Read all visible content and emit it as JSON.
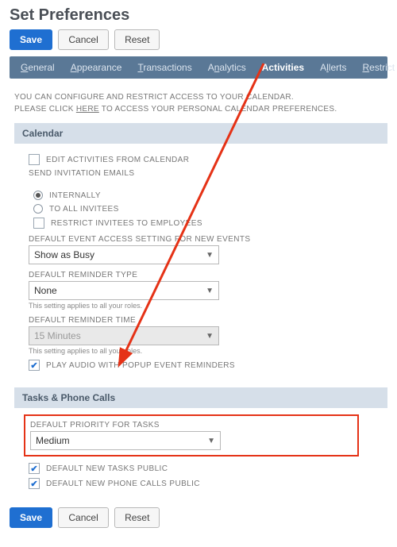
{
  "title": "Set Preferences",
  "buttons": {
    "save": "Save",
    "cancel": "Cancel",
    "reset": "Reset"
  },
  "tabs": {
    "general": "eneral",
    "appearance": "ppearance",
    "transactions": "ransactions",
    "analytics": "alytics",
    "activities": "Activities",
    "alerts": "lerts",
    "restrict": "estrict View"
  },
  "intro": {
    "line1a": "YOU CAN CONFIGURE AND RESTRICT ACCESS TO YOUR CALENDAR.",
    "line2a": "PLEASE CLICK ",
    "line2link": "HERE",
    "line2b": " TO ACCESS YOUR PERSONAL CALENDAR PREFERENCES."
  },
  "calendar": {
    "header": "Calendar",
    "edit_from_cal": "EDIT ACTIVITIES FROM CALENDAR",
    "send_inv": "SEND INVITATION EMAILS",
    "opt_internal": "INTERNALLY",
    "opt_all": "TO ALL INVITEES",
    "restrict_emp": "RESTRICT INVITEES TO EMPLOYEES",
    "def_access_lbl": "DEFAULT EVENT ACCESS SETTING FOR NEW EVENTS",
    "def_access_val": "Show as Busy",
    "def_rem_type_lbl": "DEFAULT REMINDER TYPE",
    "def_rem_type_val": "None",
    "note": "This setting applies to all your roles.",
    "def_rem_time_lbl": "DEFAULT REMINDER TIME",
    "def_rem_time_val": "15 Minutes",
    "play_audio": "PLAY AUDIO WITH POPUP EVENT REMINDERS"
  },
  "tasks": {
    "header": "Tasks & Phone Calls",
    "def_pri_lbl": "DEFAULT PRIORITY FOR TASKS",
    "def_pri_val": "Medium",
    "new_tasks_pub": "DEFAULT NEW TASKS PUBLIC",
    "new_calls_pub": "DEFAULT NEW PHONE CALLS PUBLIC"
  }
}
